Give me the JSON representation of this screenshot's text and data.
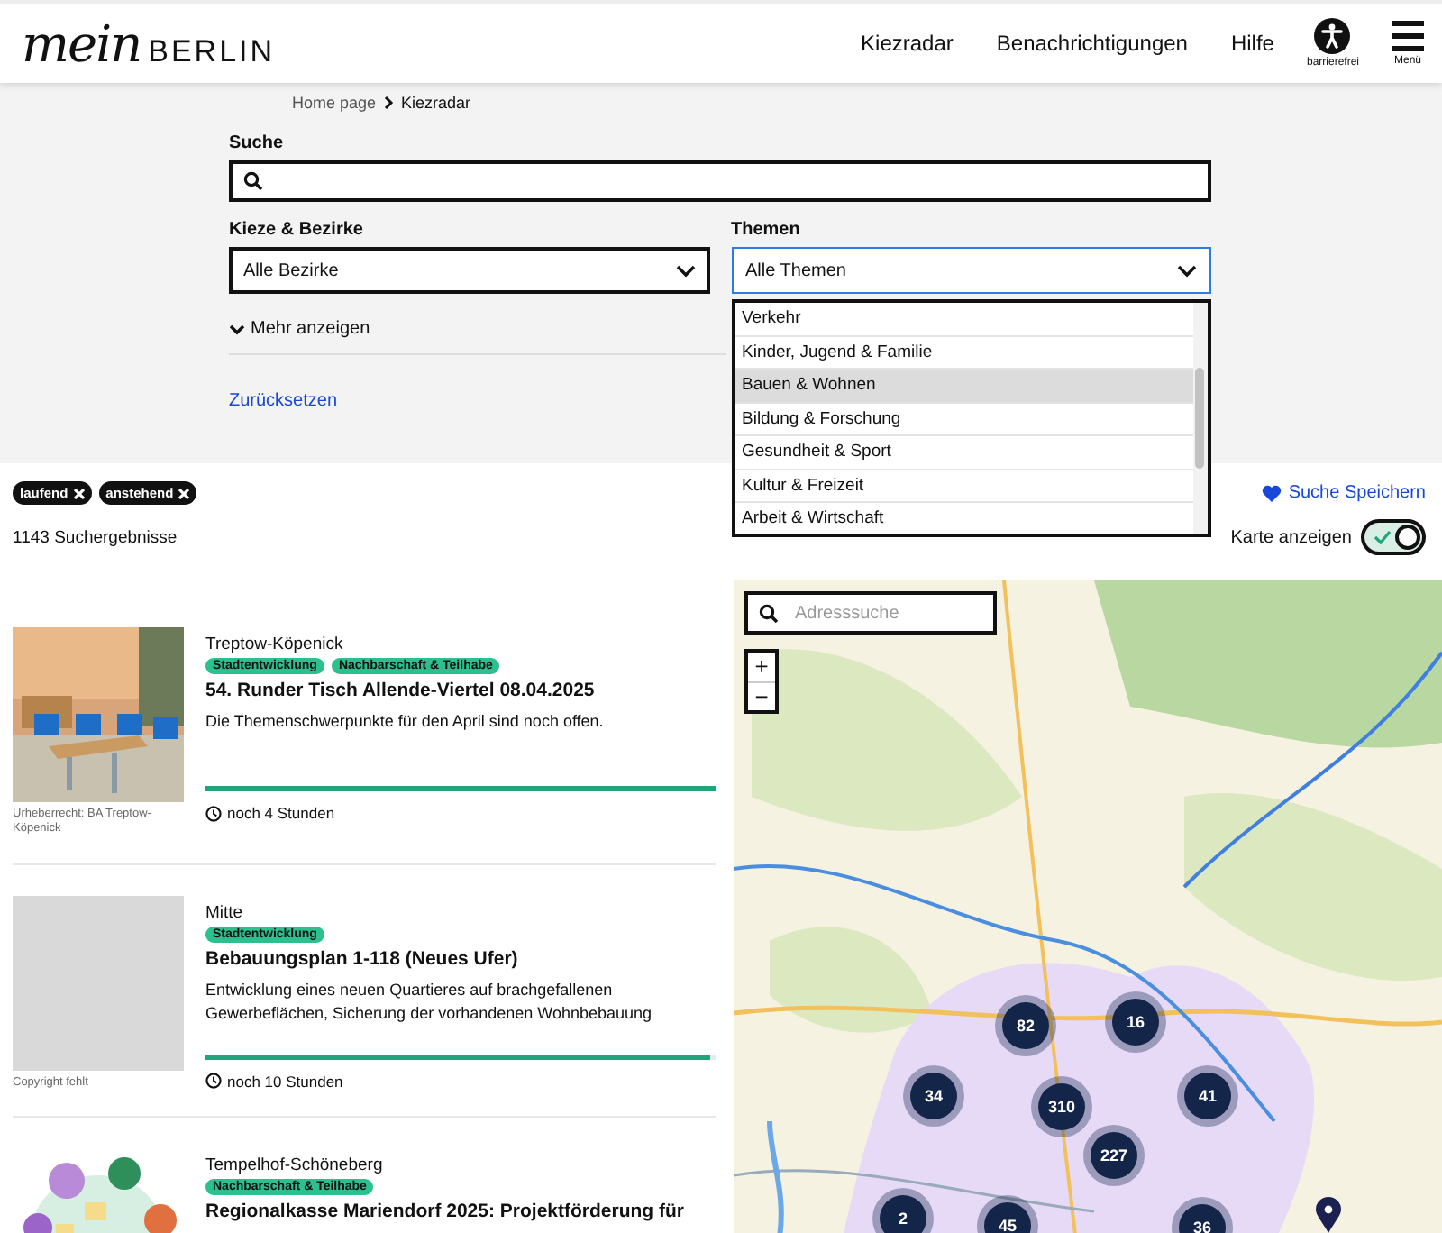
{
  "header": {
    "logo_script": "mein",
    "logo_word": "BERLIN",
    "nav": [
      "Kiezradar",
      "Benachrichtigungen",
      "Hilfe"
    ],
    "accessibility_label": "barrierefrei",
    "menu_label": "Menü"
  },
  "breadcrumb": [
    "Home page",
    "Kiezradar"
  ],
  "filters": {
    "search_label": "Suche",
    "district_label": "Kieze & Bezirke",
    "district_value": "Alle Bezirke",
    "topic_label": "Themen",
    "topic_value": "Alle Themen",
    "topic_open": true,
    "topic_options": [
      {
        "label": "Verkehr",
        "selected": false
      },
      {
        "label": "Kinder, Jugend & Familie",
        "selected": false
      },
      {
        "label": "Bauen & Wohnen",
        "selected": true
      },
      {
        "label": "Bildung & Forschung",
        "selected": false
      },
      {
        "label": "Gesundheit & Sport",
        "selected": false
      },
      {
        "label": "Kultur & Freizeit",
        "selected": false
      },
      {
        "label": "Arbeit & Wirtschaft",
        "selected": false
      }
    ],
    "more": "Mehr anzeigen",
    "reset": "Zurücksetzen"
  },
  "active_filters": [
    "laufend",
    "anstehend"
  ],
  "save_search": "Suche Speichern",
  "result_count": "1143 Suchergebnisse",
  "map_toggle": {
    "label": "Karte anzeigen",
    "on": true
  },
  "results": [
    {
      "credit": "Urheberrecht: BA Treptow-Köpenick",
      "district": "Treptow-Köpenick",
      "tags": [
        "Stadtentwicklung",
        "Nachbarschaft & Teilhabe"
      ],
      "title": "54. Runder Tisch Allende-Viertel 08.04.2025",
      "text": "Die Themenschwerpunkte für den April sind noch offen.",
      "level": 1,
      "time": "noch 4 Stunden"
    },
    {
      "kind": "placeholder",
      "credit": "Copyright fehlt",
      "district": "Mitte",
      "tags": [
        "Stadtentwicklung"
      ],
      "title": "Bebauungsplan 1-118 (Neues Ufer)",
      "text": "Entwicklung eines neuen Quartieres auf brachgefallenen Gewerbeflächen, Sicherung der vorhandenen Wohnbebauung",
      "level": 0.99,
      "time": "noch 10 Stunden"
    },
    {
      "kind": "illustration",
      "district": "Tempelhof-Schöneberg",
      "tags": [
        "Nachbarschaft & Teilhabe"
      ],
      "title": "Regionalkasse Mariendorf 2025: Projektförderung für"
    }
  ],
  "map": {
    "search_placeholder": "Adresssuche",
    "zoom_in": "+",
    "zoom_out": "−",
    "clusters": [
      "82",
      "16",
      "34",
      "310",
      "41",
      "227",
      "2",
      "45",
      "36"
    ]
  }
}
